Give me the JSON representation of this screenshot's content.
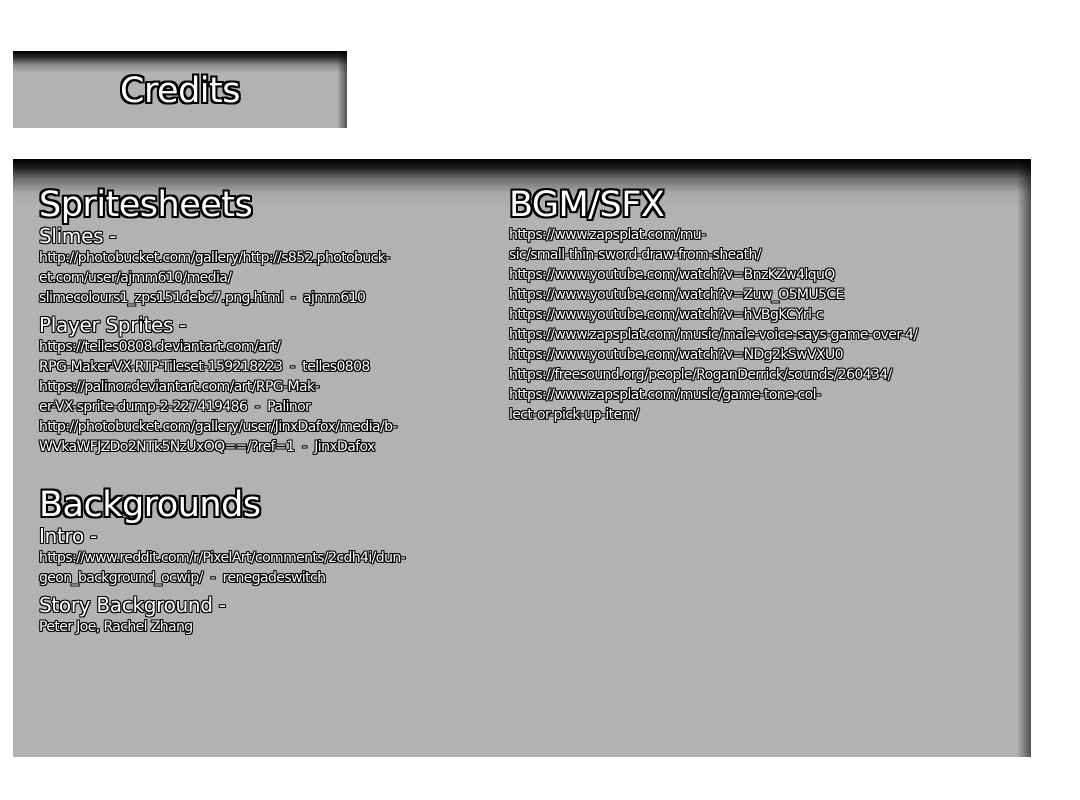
{
  "title": "Credits",
  "left": {
    "spritesheets": {
      "heading": "Spritesheets",
      "groups": [
        {
          "label": "Slimes -",
          "lines": [
            "http://photobucket.com/gallery/http://s852.photobuck-",
            "et.com/user/ajmm610/media/",
            "slimecolours1_zps151debc7.png.html  -  ajmm610"
          ]
        },
        {
          "label": "Player Sprites -",
          "lines": [
            "https://telles0808.deviantart.com/art/",
            "RPG-Maker-VX-RTP-Tileset-159218223  -  telles0808",
            "https://palinor.deviantart.com/art/RPG-Mak-",
            "er-VX-sprite-dump-2-227419486  -  Palinor",
            "http://photobucket.com/gallery/user/JinxDafox/media/b-",
            "WVkaWFJZDo2NTk5NzUxOQ==/?ref=1  -  JinxDafox"
          ]
        }
      ]
    },
    "backgrounds": {
      "heading": "Backgrounds",
      "groups": [
        {
          "label": "Intro -",
          "lines": [
            "https://www.reddit.com/r/PixelArt/comments/2cdh4i/dun-",
            "geon_background_ocwip/  -  renegadeswitch"
          ]
        },
        {
          "label": "Story Background -",
          "lines": [
            "Peter Joe, Rachel Zhang"
          ]
        }
      ]
    }
  },
  "right": {
    "bgm": {
      "heading": "BGM/SFX",
      "lines": [
        "https://www.zapsplat.com/mu-",
        "sic/small-thin-sword-draw-from-sheath/",
        "https://www.youtube.com/watch?v=BnzKZw4lquQ",
        "https://www.youtube.com/watch?v=Zuw_O5MU5CE",
        "https://www.youtube.com/watch?v=hVBgKCYrl-c",
        "https://www.zapsplat.com/music/male-voice-says-game-over-4/",
        "https://www.youtube.com/watch?v=NDg2kSwVXU0",
        "https://freesound.org/people/RoganDerrick/sounds/260434/",
        "https://www.zapsplat.com/music/game-tone-col-",
        "lect-or-pick-up-item/"
      ]
    }
  }
}
